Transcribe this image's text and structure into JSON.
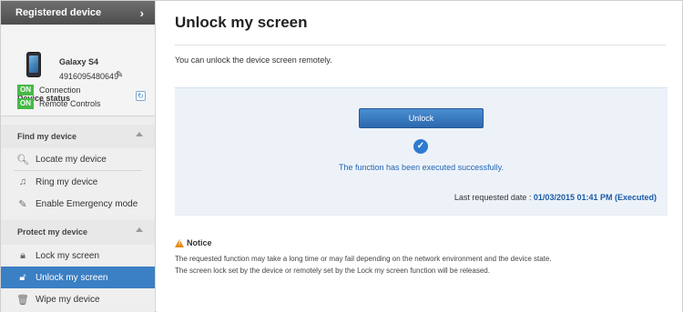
{
  "sidebar": {
    "registered_device_label": "Registered device",
    "device": {
      "name": "Galaxy S4",
      "number": "4916095480649"
    },
    "device_status": {
      "title": "Device status",
      "items": [
        {
          "badge": "ON",
          "label": "Connection"
        },
        {
          "badge": "ON",
          "label": "Remote Controls"
        }
      ]
    },
    "sections": [
      {
        "title": "Find my device",
        "items": [
          {
            "label": "Locate my device",
            "icon": "search-icon"
          },
          {
            "label": "Ring my device",
            "icon": "music-note-icon"
          },
          {
            "label": "Enable Emergency mode",
            "icon": "wrench-icon"
          }
        ]
      },
      {
        "title": "Protect my device",
        "items": [
          {
            "label": "Lock my screen",
            "icon": "lock-icon"
          },
          {
            "label": "Unlock my screen",
            "icon": "unlock-icon",
            "active": true
          },
          {
            "label": "Wipe my device",
            "icon": "trash-icon"
          }
        ]
      }
    ]
  },
  "main": {
    "title": "Unlock my screen",
    "intro": "You can unlock the device screen remotely.",
    "unlock_button": "Unlock",
    "success_message": "The function has been executed successfully.",
    "last_requested_label": "Last requested date :",
    "last_requested_value": "01/03/2015 01:41 PM  (Executed)",
    "notice": {
      "title": "Notice",
      "lines": [
        "The requested function may take a long time or may fail depending on the network environment and the device state.",
        "The screen lock set by the device or remotely set by the Lock my screen function will be released."
      ]
    }
  },
  "colors": {
    "active_nav": "#3b7fc4",
    "on_badge": "#46b846",
    "accent_blue": "#2266b4",
    "warning": "#e58b1a"
  }
}
